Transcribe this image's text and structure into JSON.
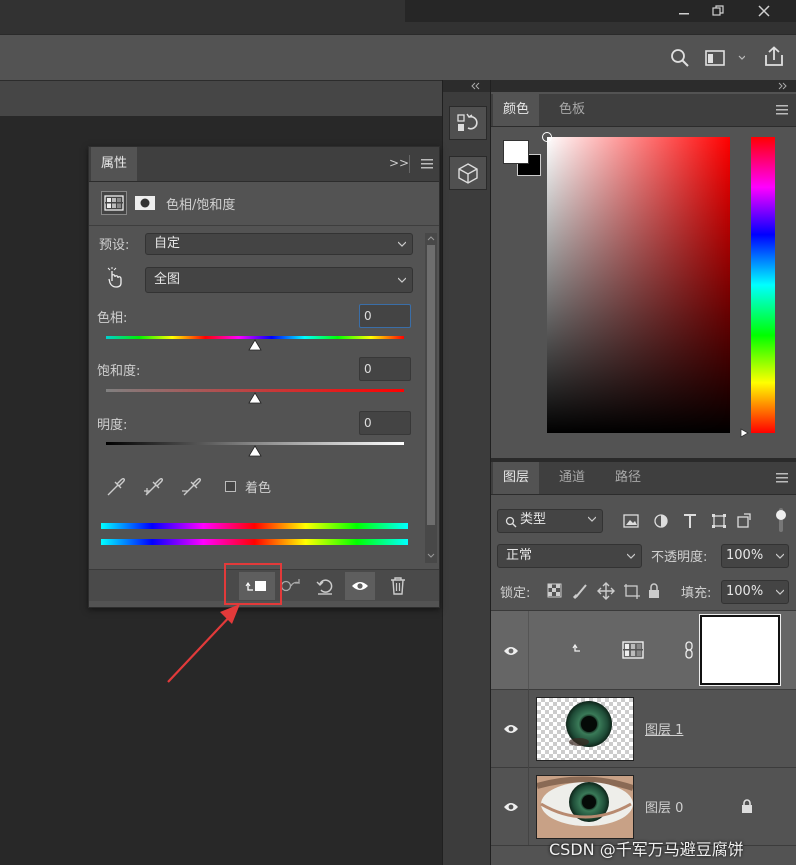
{
  "properties_panel": {
    "title": "属性",
    "collapse_glyph": ">>",
    "adjustment_name": "色相/饱和度",
    "preset_label": "预设:",
    "preset_value": "自定",
    "range_value": "全图",
    "hue_label": "色相:",
    "hue_value": "0",
    "saturation_label": "饱和度:",
    "saturation_value": "0",
    "lightness_label": "明度:",
    "lightness_value": "0",
    "colorize_label": "着色"
  },
  "color_panel": {
    "tabs": [
      "颜色",
      "色板"
    ],
    "foreground": "#ffffff",
    "background": "#000000",
    "picker_hue": "#ff0000"
  },
  "layers_panel": {
    "tabs": [
      "图层",
      "通道",
      "路径"
    ],
    "filter_label": "类型",
    "blend_mode": "正常",
    "opacity_label": "不透明度:",
    "opacity_value": "100%",
    "lock_label": "锁定:",
    "fill_label": "填充:",
    "fill_value": "100%",
    "layers": [
      {
        "name": "",
        "type": "adjustment-hue-saturation",
        "clipped": true,
        "selected": true
      },
      {
        "name": "图层 1",
        "type": "pixel",
        "thumbnail": "eye-iris-transparent"
      },
      {
        "name": "图层 0",
        "type": "pixel",
        "thumbnail": "eye-photo",
        "locked": true
      }
    ]
  },
  "watermark": "CSDN @千军万马避豆腐饼",
  "colors": {
    "accent_highlight": "#e23a3a",
    "panel_bg": "#535353",
    "panel_header": "#3f3f3f"
  }
}
